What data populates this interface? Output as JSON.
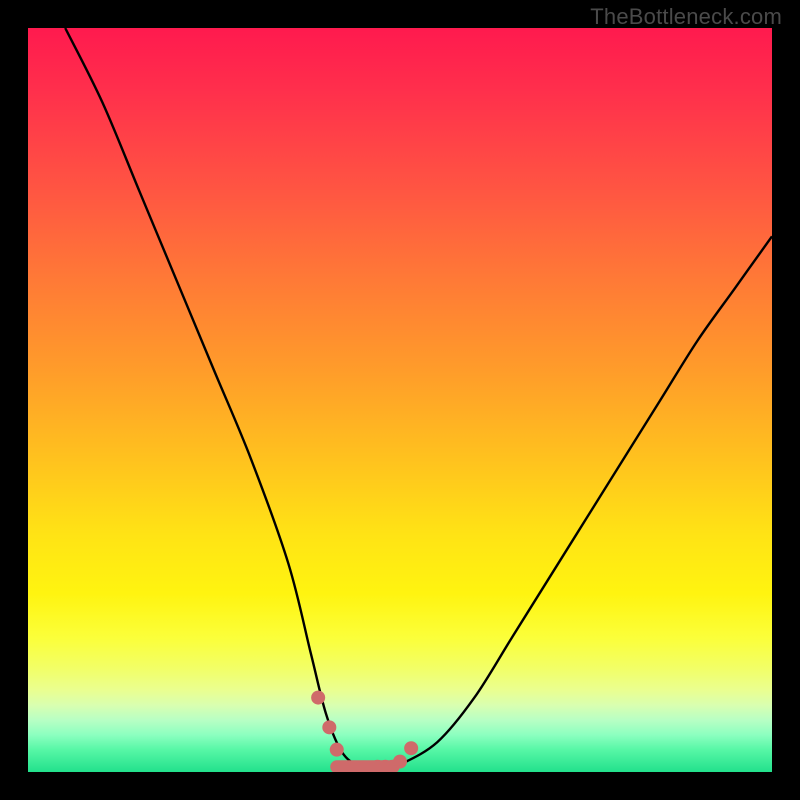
{
  "watermark": "TheBottleneck.com",
  "chart_data": {
    "type": "line",
    "title": "",
    "xlabel": "",
    "ylabel": "",
    "xlim": [
      0,
      100
    ],
    "ylim": [
      0,
      100
    ],
    "grid": false,
    "series": [
      {
        "name": "bottleneck-curve",
        "color": "#000000",
        "x": [
          5,
          10,
          15,
          20,
          25,
          30,
          35,
          38,
          40,
          42,
          44,
          46,
          48,
          50,
          55,
          60,
          65,
          70,
          75,
          80,
          85,
          90,
          95,
          100
        ],
        "values": [
          100,
          90,
          78,
          66,
          54,
          42,
          28,
          16,
          8,
          3,
          1,
          0.5,
          0.5,
          1,
          4,
          10,
          18,
          26,
          34,
          42,
          50,
          58,
          65,
          72
        ]
      }
    ],
    "highlight_points": {
      "name": "trough-markers",
      "color": "#cf6a6a",
      "x": [
        39,
        40.5,
        41.5,
        47,
        48,
        49,
        50,
        51.5
      ],
      "values": [
        10,
        6,
        3,
        0.7,
        0.7,
        0.7,
        1.4,
        3.2
      ]
    },
    "trough_bar": {
      "color": "#cf6a6a",
      "x_start": 41.5,
      "x_end": 49,
      "y": 0.7
    }
  }
}
